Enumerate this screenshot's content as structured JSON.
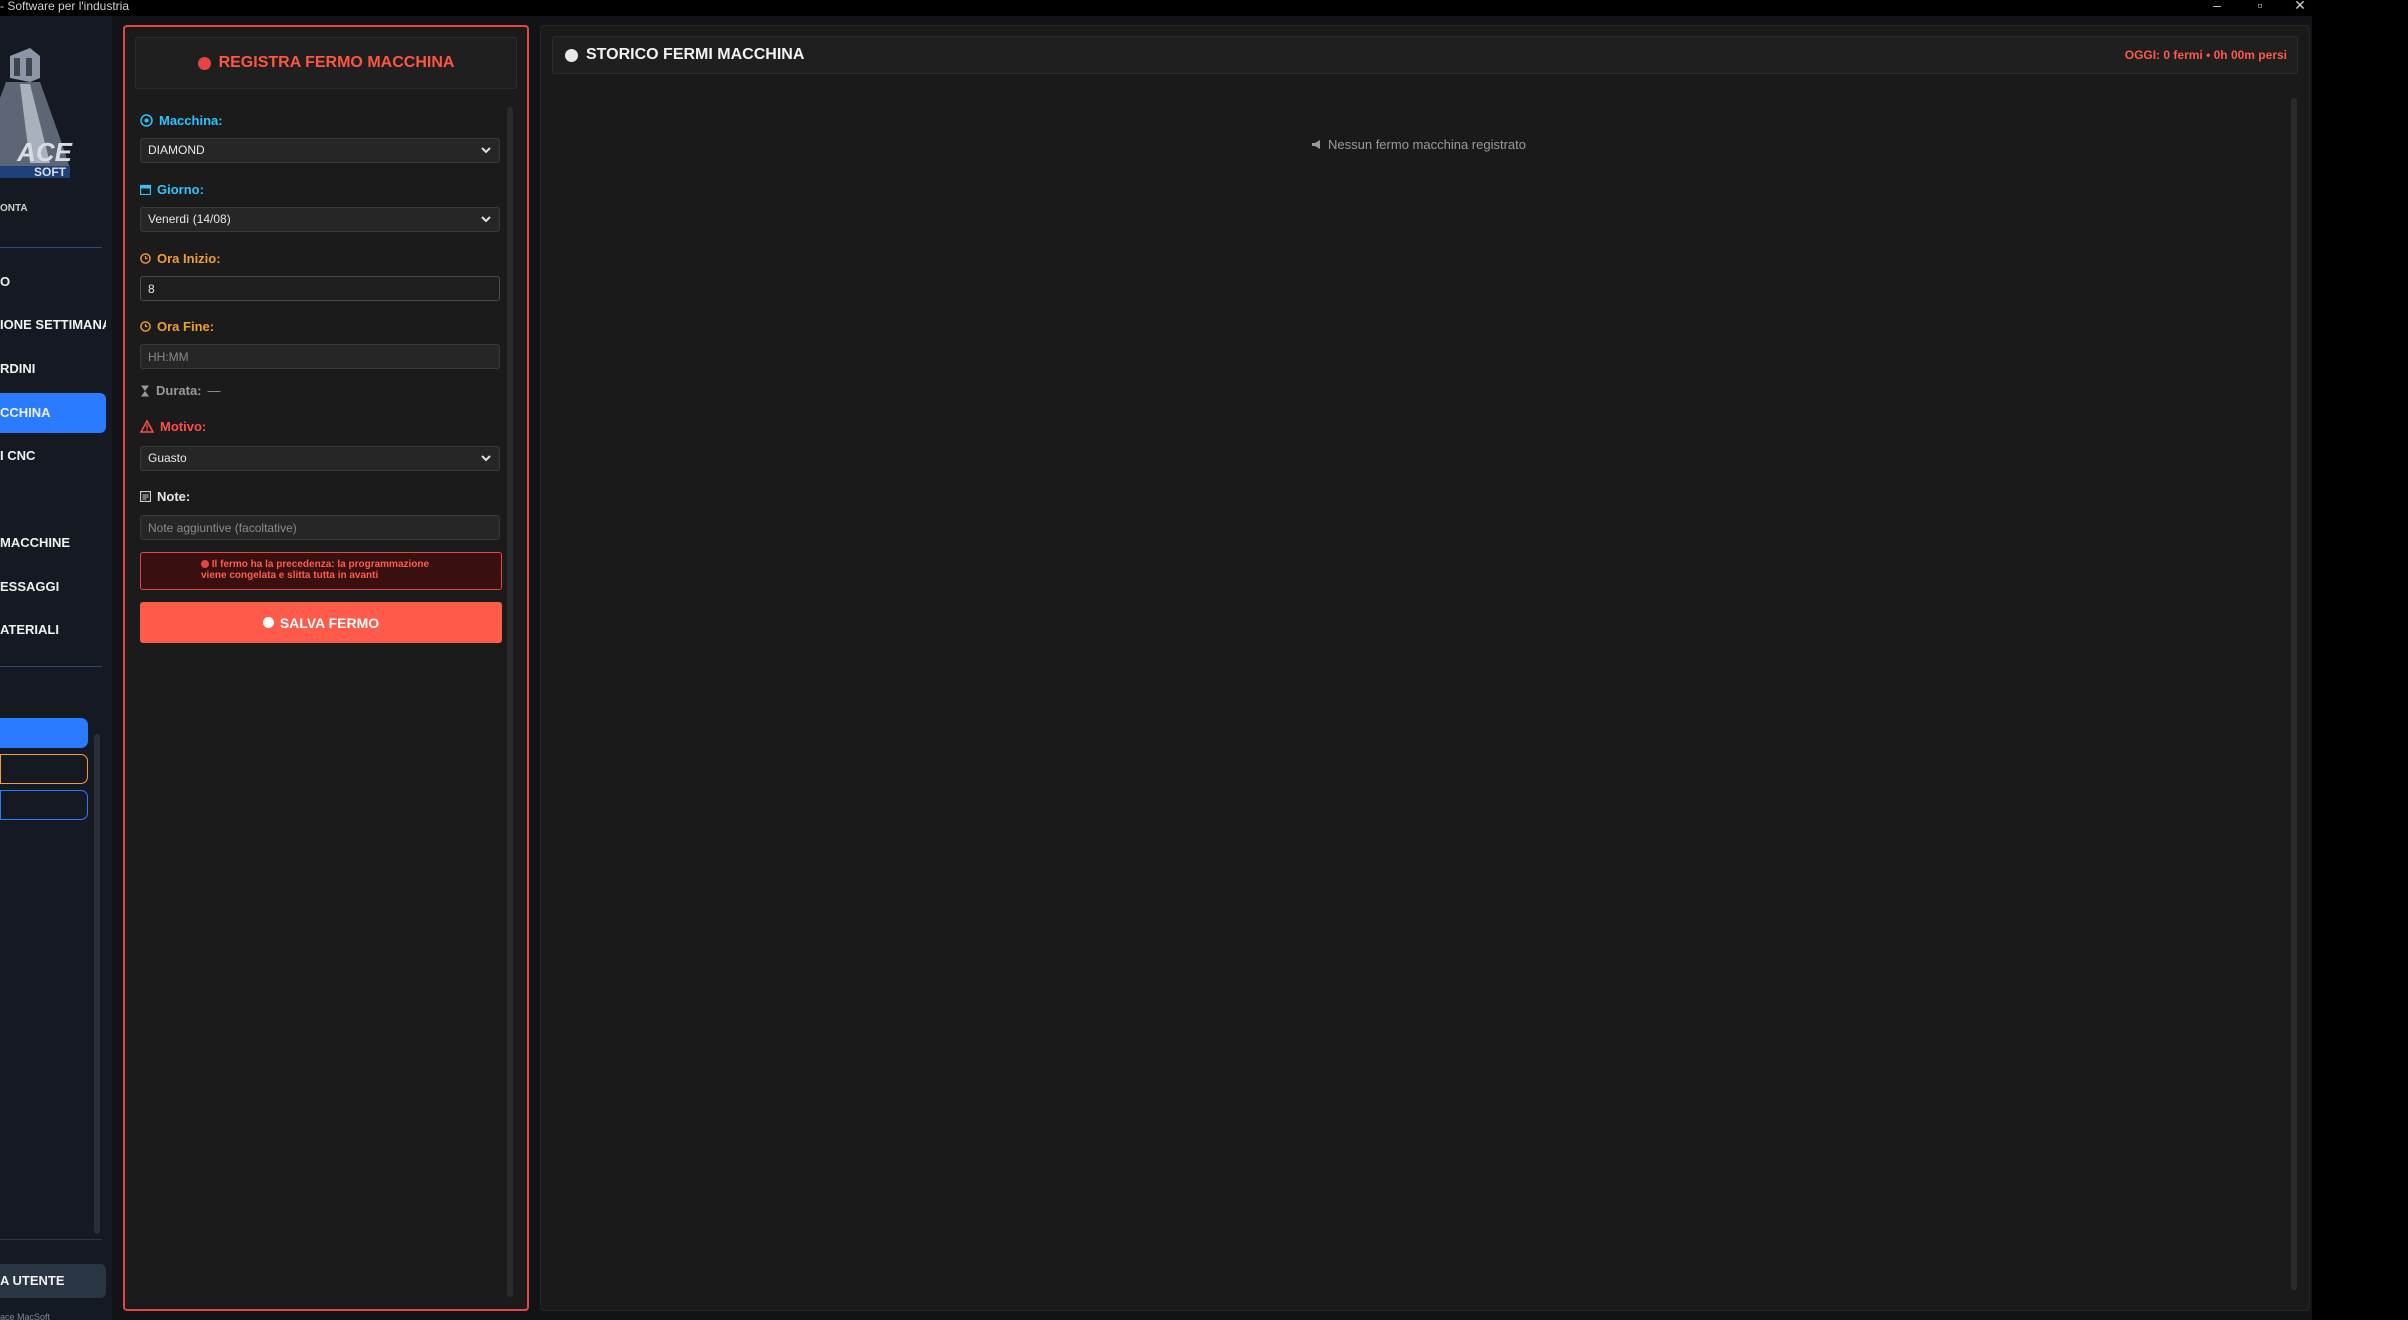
{
  "window": {
    "title": "- Software per l'industria",
    "minimize_glyph": "–",
    "maximize_glyph": "▫",
    "close_glyph": "✕"
  },
  "sidebar": {
    "logo_text": "ACE",
    "logo_subtext": "SOFT",
    "logo_caption": "ONTA",
    "items": [
      {
        "label": "O",
        "active": false
      },
      {
        "label": "IONE SETTIMANA",
        "active": false
      },
      {
        "label": "RDINI",
        "active": false
      },
      {
        "label": "CCHINA",
        "active": true
      },
      {
        "label": "I CNC",
        "active": false
      },
      {
        "label": "MACCHINE",
        "active": false
      },
      {
        "label": "ESSAGGI",
        "active": false
      },
      {
        "label": "ATERIALI",
        "active": false
      }
    ],
    "user_button": "A UTENTE",
    "footer": "ace MacSoft"
  },
  "form": {
    "title": "REGISTRA FERMO MACCHINA",
    "machine": {
      "label": "Macchina:",
      "value": "DIAMOND"
    },
    "day": {
      "label": "Giorno:",
      "value": "Venerdì (14/08)"
    },
    "start": {
      "label": "Ora Inizio:",
      "value": "8"
    },
    "end": {
      "label": "Ora Fine:",
      "placeholder": "HH:MM"
    },
    "duration": {
      "label": "Durata:",
      "value": "—"
    },
    "reason": {
      "label": "Motivo:",
      "value": "Guasto"
    },
    "notes": {
      "label": "Note:",
      "placeholder": "Note aggiuntive (facoltative)"
    },
    "warning": "Il fermo ha la precedenza: la programmazione viene congelata e slitta tutta in avanti",
    "save_button": "SALVA FERMO"
  },
  "history": {
    "title": "STORICO FERMI MACCHINA",
    "stats": "OGGI: 0 fermi • 0h 00m persi",
    "empty_message": "Nessun fermo macchina registrato"
  },
  "colors": {
    "accent_red": "#ff5a4a",
    "accent_blue": "#2a7bff",
    "label_cyan": "#2ec4ff",
    "label_orange": "#f0a030",
    "label_red": "#ff4d4d"
  },
  "icons": [
    "stop-icon",
    "gear-icon",
    "calendar-icon",
    "clock-icon",
    "hourglass-icon",
    "warning-icon",
    "note-icon",
    "chevron-down-icon",
    "megaphone-icon",
    "record-icon"
  ]
}
